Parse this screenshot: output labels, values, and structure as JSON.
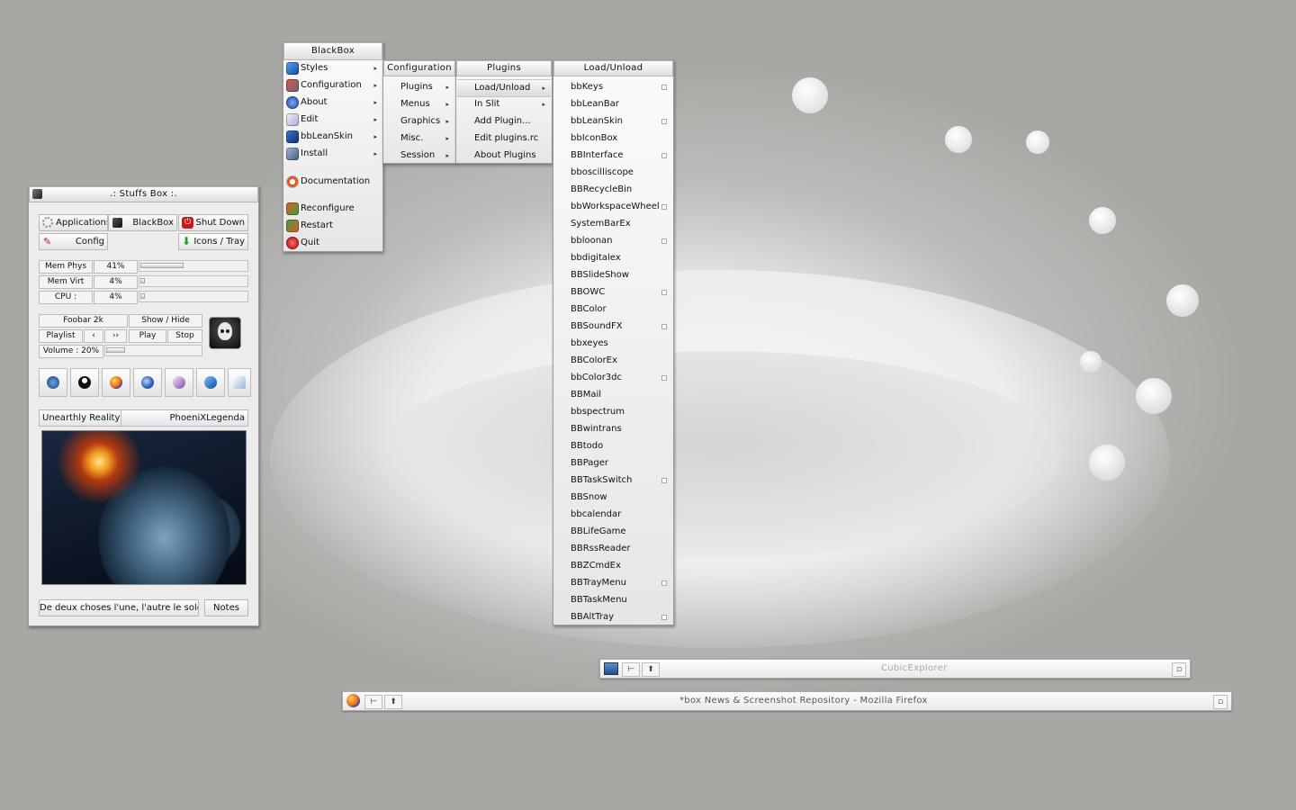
{
  "blackbox_menu": {
    "title": "BlackBox",
    "items": [
      {
        "label": "Styles",
        "icon": "styles-icon",
        "arrow": true
      },
      {
        "label": "Configuration",
        "icon": "tools-icon",
        "arrow": true
      },
      {
        "label": "About",
        "icon": "info-icon",
        "arrow": true
      },
      {
        "label": "Edit",
        "icon": "edit-icon",
        "arrow": true
      },
      {
        "label": "bbLeanSkin",
        "icon": "skin-icon",
        "arrow": true
      },
      {
        "label": "Install",
        "icon": "install-icon",
        "arrow": true
      },
      {
        "label": "Documentation",
        "icon": "lifebuoy-icon",
        "arrow": false
      },
      {
        "label": "Reconfigure",
        "icon": "reconfigure-icon",
        "arrow": false
      },
      {
        "label": "Restart",
        "icon": "restart-icon",
        "arrow": false
      },
      {
        "label": "Quit",
        "icon": "quit-icon",
        "arrow": false
      }
    ]
  },
  "configuration_menu": {
    "title": "Configuration",
    "items": [
      "Plugins",
      "Menus",
      "Graphics",
      "Misc.",
      "Session"
    ]
  },
  "plugins_menu": {
    "title": "Plugins",
    "items": [
      "Load/Unload",
      "In Slit",
      "Add Plugin...",
      "Edit plugins.rc",
      "About Plugins"
    ]
  },
  "load_unload_menu": {
    "title": "Load/Unload",
    "items": [
      {
        "label": "bbKeys",
        "checked": true
      },
      {
        "label": "bbLeanBar",
        "checked": false
      },
      {
        "label": "bbLeanSkin",
        "checked": true
      },
      {
        "label": "bbIconBox",
        "checked": false
      },
      {
        "label": "BBInterface",
        "checked": true
      },
      {
        "label": "bboscilliscope",
        "checked": false
      },
      {
        "label": "BBRecycleBin",
        "checked": false
      },
      {
        "label": "bbWorkspaceWheel",
        "checked": true
      },
      {
        "label": "SystemBarEx",
        "checked": false
      },
      {
        "label": "bbloonan",
        "checked": true
      },
      {
        "label": "bbdigitalex",
        "checked": false
      },
      {
        "label": "BBSlideShow",
        "checked": false
      },
      {
        "label": "BBOWC",
        "checked": true
      },
      {
        "label": "BBColor",
        "checked": false
      },
      {
        "label": "BBSoundFX",
        "checked": true
      },
      {
        "label": "bbxeyes",
        "checked": false
      },
      {
        "label": "BBColorEx",
        "checked": false
      },
      {
        "label": "bbColor3dc",
        "checked": true
      },
      {
        "label": "BBMail",
        "checked": false
      },
      {
        "label": "bbspectrum",
        "checked": false
      },
      {
        "label": "BBwintrans",
        "checked": false
      },
      {
        "label": "BBtodo",
        "checked": false
      },
      {
        "label": "BBPager",
        "checked": false
      },
      {
        "label": "BBTaskSwitch",
        "checked": true
      },
      {
        "label": "BBSnow",
        "checked": false
      },
      {
        "label": "bbcalendar",
        "checked": false
      },
      {
        "label": "BBLifeGame",
        "checked": false
      },
      {
        "label": "BBRssReader",
        "checked": false
      },
      {
        "label": "BBZCmdEx",
        "checked": false
      },
      {
        "label": "BBTrayMenu",
        "checked": true
      },
      {
        "label": "BBTaskMenu",
        "checked": false
      },
      {
        "label": "BBAltTray",
        "checked": true
      }
    ]
  },
  "stuffs_box": {
    "title": ".: Stuffs Box :.",
    "applications": "Applications",
    "blackbox": "BlackBox",
    "shutdown": "Shut Down",
    "config": "Config",
    "icons_tray": "Icons / Tray",
    "mem_phys_label": "Mem Phys",
    "mem_phys_value": "41%",
    "mem_phys_level": 0.41,
    "mem_virt_label": "Mem Virt",
    "mem_virt_value": "4%",
    "mem_virt_level": 0.04,
    "cpu_label": "CPU :",
    "cpu_value": "4%",
    "cpu_level": 0.04,
    "foobar": "Foobar 2k",
    "show_hide": "Show / Hide",
    "playlist": "Playlist",
    "prev": "‹",
    "next": "››",
    "play": "Play",
    "stop": "Stop",
    "volume": "Volume : 20%",
    "volume_level": 0.2,
    "launchers": [
      "computer-icon",
      "tux-icon",
      "firefox-icon",
      "thunderbird-icon",
      "document-icon",
      "blackbox-style-icon",
      "folder-icon"
    ],
    "wallpaper_name": "Unearthly Reality",
    "wallpaper_author": "PhoeniXLegenda",
    "quote": "De deux choses l'une, l'autre le soleil.",
    "notes": "Notes"
  },
  "tasks": [
    {
      "title": "CubicExplorer",
      "icon": "computer-icon"
    },
    {
      "title": "*box News & Screenshot Repository - Mozilla Firefox",
      "icon": "firefox-icon"
    }
  ]
}
